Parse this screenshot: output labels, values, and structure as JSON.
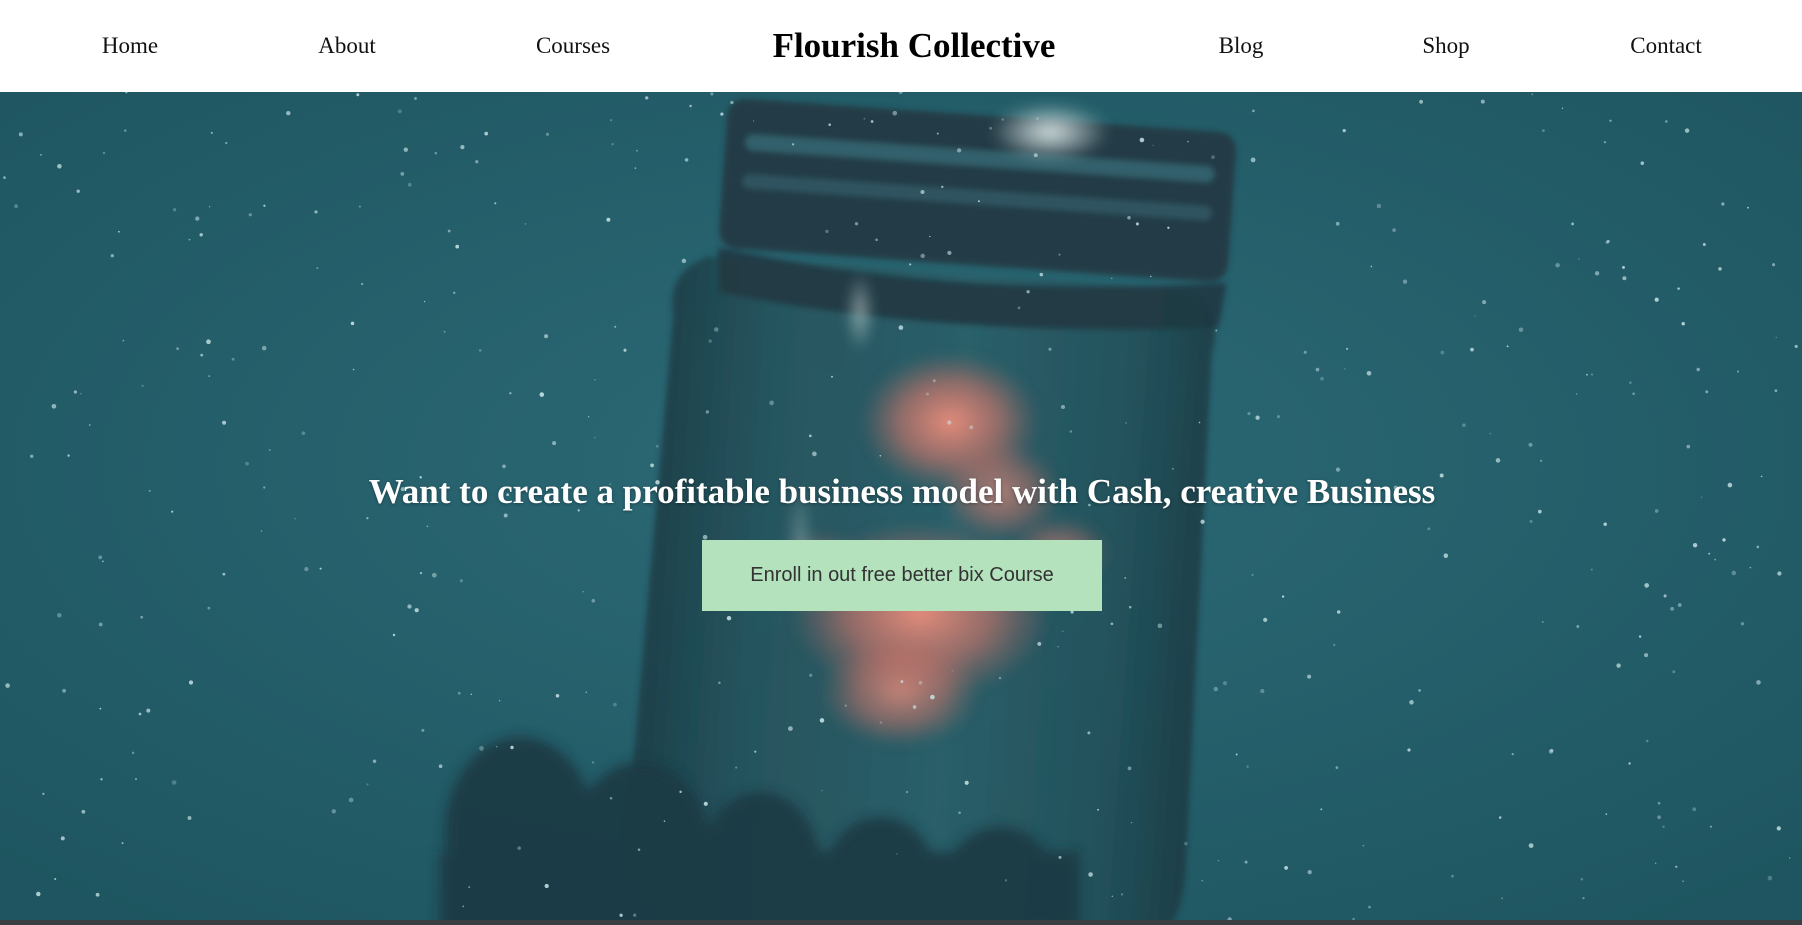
{
  "nav": {
    "brand": "Flourish Collective",
    "left_links": [
      "Home",
      "About",
      "Courses"
    ],
    "right_links": [
      "Blog",
      "Shop",
      "Contact"
    ]
  },
  "hero": {
    "background_image": "starry-jar-image",
    "headline": "Want to create a profitable business model with Cash, creative Business",
    "cta_label": "Enroll in out free better bix Course"
  },
  "colors": {
    "hero_teal": "#235a66",
    "cta_green": "#b3e2bd",
    "nebula_pink": "#e08070"
  }
}
